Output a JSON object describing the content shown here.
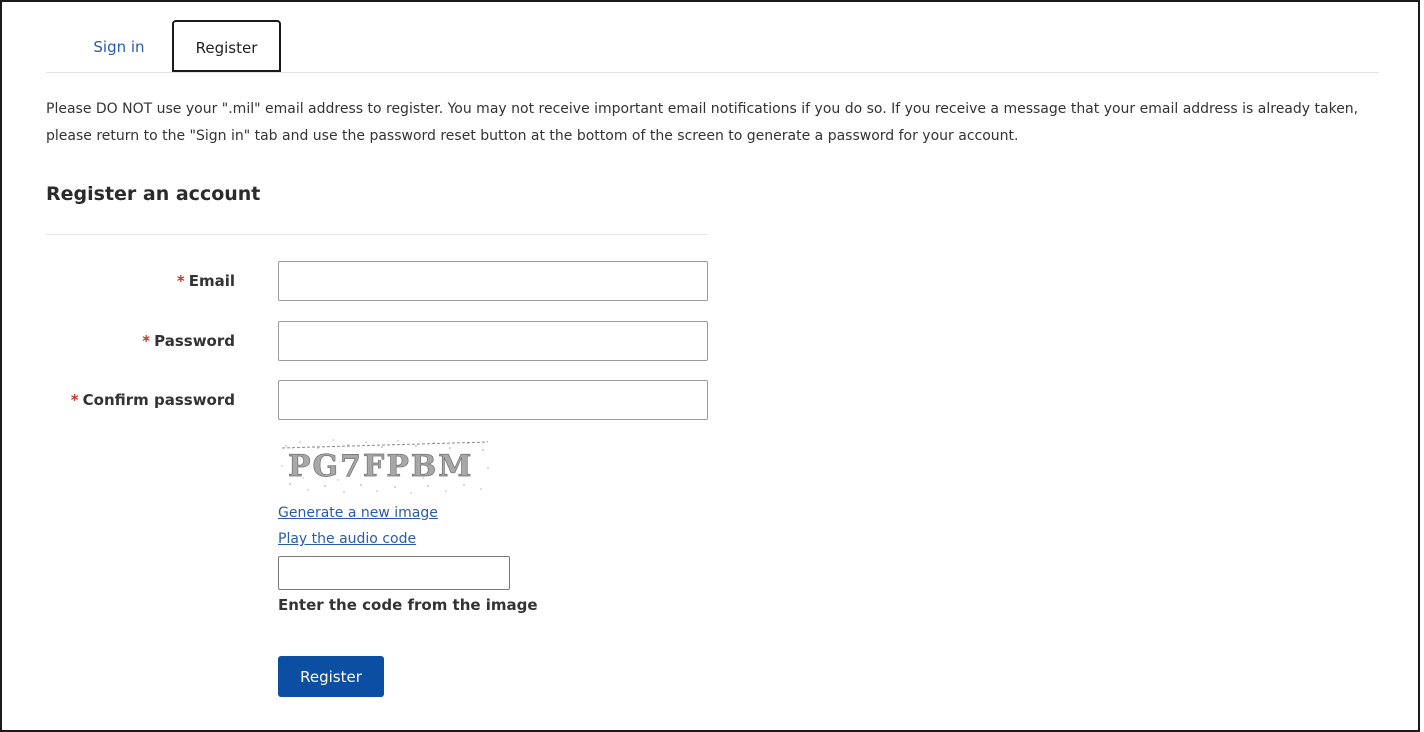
{
  "tabs": {
    "sign_in": "Sign in",
    "register": "Register"
  },
  "notice": "Please DO NOT use your \".mil\" email address to register. You may not receive important email notifications if you do so. If you receive a message that your email address is already taken, please return to the \"Sign in\" tab and use the password reset button at the bottom of the screen to generate a password for your account.",
  "form": {
    "heading": "Register an account",
    "required_marker": "*",
    "email_label": "Email",
    "password_label": "Password",
    "confirm_label": "Confirm password",
    "email_value": "",
    "password_value": "",
    "confirm_value": ""
  },
  "captcha": {
    "code_text": "PG7FPBM",
    "new_image_link": "Generate a new image",
    "audio_link": "Play the audio code",
    "input_value": "",
    "input_label": "Enter the code from the image"
  },
  "submit_label": "Register",
  "colors": {
    "link": "#2a5ba8",
    "button": "#0b4ea2",
    "required": "#c0392b"
  }
}
